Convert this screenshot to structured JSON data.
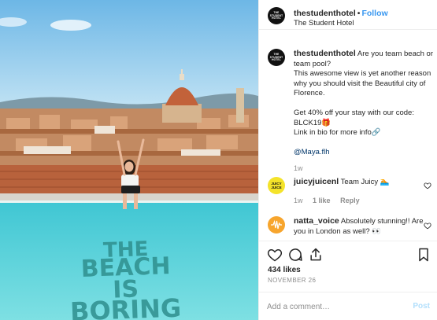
{
  "post": {
    "username": "thestudenthotel",
    "follow_label": "Follow",
    "location": "The Student Hotel",
    "avatar_text": "THE STUDENT HOTEL",
    "photo_text": [
      "THE",
      "BEACH",
      "IS",
      "BORING"
    ]
  },
  "caption": {
    "username": "thestudenthotel",
    "lines": [
      "Are you team beach or team pool?",
      "This awesome view is yet another reason why you should visit the Beautiful city of Florence.",
      "Get 40% off your stay with our code: BLCK19🎁",
      "Link in bio for more info🔗",
      "@Maya.flh"
    ],
    "time": "1w"
  },
  "comments": [
    {
      "username": "juicyjuicenl",
      "text": "Team Juicy 🏊",
      "avatar_text": "JUICY JUICE",
      "time": "1w",
      "likes": "1 like",
      "reply": "Reply"
    },
    {
      "username": "natta_voice",
      "text": "Absolutely stunning!! Are you in London as well? 👀"
    }
  ],
  "actions": {
    "like_icon": "heart-icon",
    "comment_icon": "comment-icon",
    "share_icon": "share-icon",
    "save_icon": "bookmark-icon"
  },
  "stats": {
    "likes": "434 likes",
    "date": "NOVEMBER 26"
  },
  "add_comment": {
    "placeholder": "Add a comment…",
    "post_label": "Post"
  },
  "colors": {
    "link_blue": "#3897f0",
    "post_disabled": "#b2dffc",
    "border": "#efefef"
  }
}
